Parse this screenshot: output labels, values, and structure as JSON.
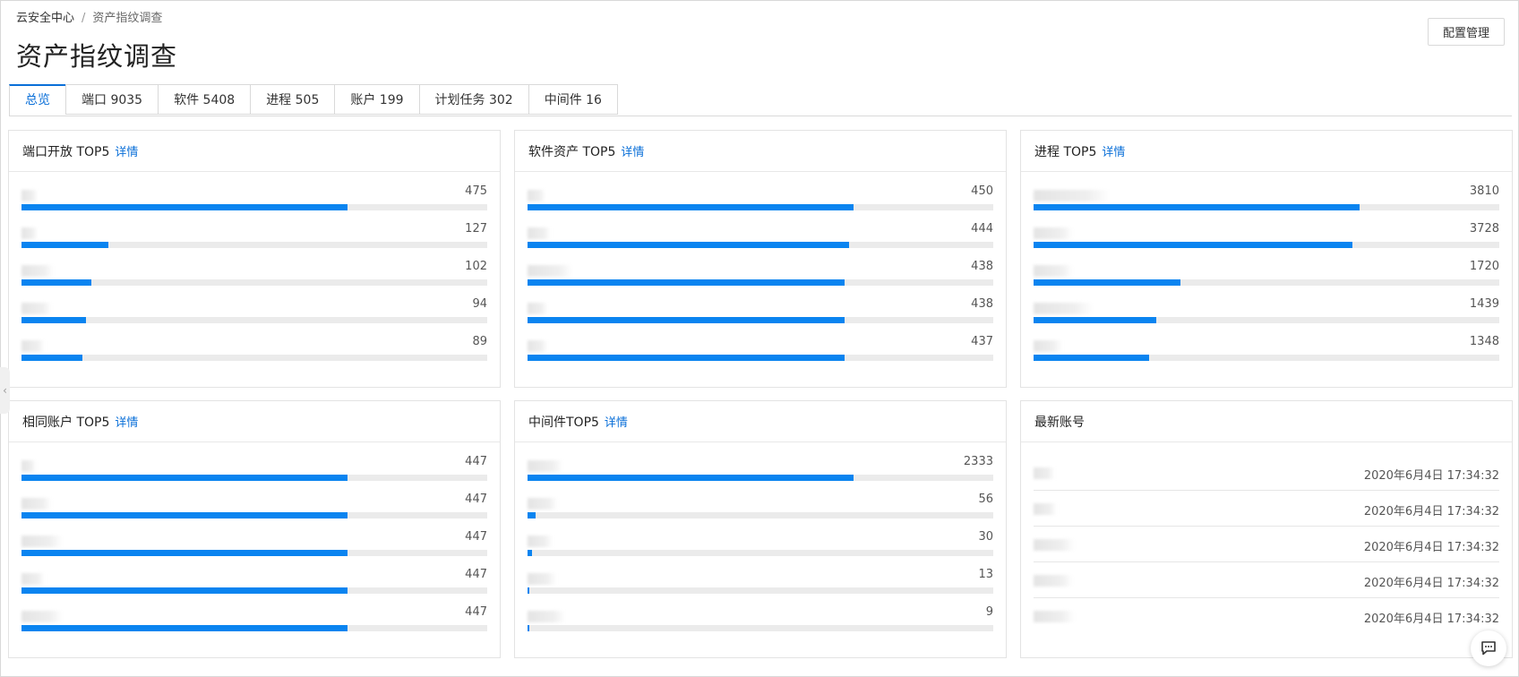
{
  "breadcrumb": {
    "root": "云安全中心",
    "separator": "/",
    "current": "资产指纹调查"
  },
  "page_title": "资产指纹调查",
  "config_button": "配置管理",
  "tabs": [
    {
      "label": "总览",
      "active": true
    },
    {
      "label": "端口 9035",
      "active": false
    },
    {
      "label": "软件 5408",
      "active": false
    },
    {
      "label": "进程 505",
      "active": false
    },
    {
      "label": "账户 199",
      "active": false
    },
    {
      "label": "计划任务 302",
      "active": false
    },
    {
      "label": "中间件 16",
      "active": false
    }
  ],
  "detail_link": "详情",
  "colors": {
    "accent": "#0a6fd8",
    "bar_fill": "#0a84f0",
    "bar_track": "#ebebeb"
  },
  "cards": {
    "port": {
      "title": "端口开放 TOP5",
      "values": [
        "475",
        "127",
        "102",
        "94",
        "89"
      ],
      "fractions": [
        0.7,
        0.187,
        0.15,
        0.138,
        0.131
      ]
    },
    "software": {
      "title": "软件资产 TOP5",
      "values": [
        "450",
        "444",
        "438",
        "438",
        "437"
      ],
      "fractions": [
        0.7,
        0.69,
        0.681,
        0.681,
        0.68
      ]
    },
    "process": {
      "title": "进程 TOP5",
      "values": [
        "3810",
        "3728",
        "1720",
        "1439",
        "1348"
      ],
      "fractions": [
        0.7,
        0.685,
        0.316,
        0.264,
        0.248
      ]
    },
    "account": {
      "title": "相同账户 TOP5",
      "values": [
        "447",
        "447",
        "447",
        "447",
        "447"
      ],
      "fractions": [
        0.7,
        0.7,
        0.7,
        0.7,
        0.7
      ]
    },
    "middleware": {
      "title": "中间件TOP5",
      "values": [
        "2333",
        "56",
        "30",
        "13",
        "9"
      ],
      "fractions": [
        0.7,
        0.017,
        0.009,
        0.004,
        0.003
      ]
    },
    "latest": {
      "title": "最新账号",
      "times": [
        "2020年6月4日 17:34:32",
        "2020年6月4日 17:34:32",
        "2020年6月4日 17:34:32",
        "2020年6月4日 17:34:32",
        "2020年6月4日 17:34:32"
      ]
    }
  }
}
